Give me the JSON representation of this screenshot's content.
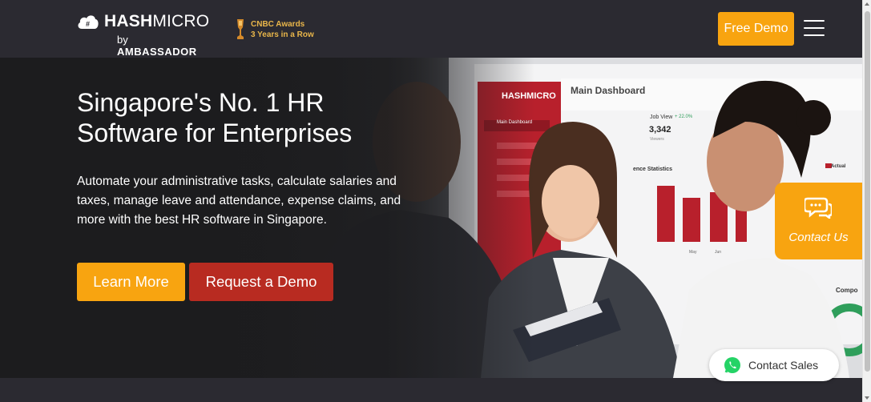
{
  "header": {
    "brand": "HASHMICRO",
    "byline_prefix": "by",
    "byline_name": "AMBASSADOR",
    "award_line1": "CNBC Awards",
    "award_line2": "3 Years in a Row",
    "free_demo_label": "Free Demo",
    "menu_icon": "hamburger-icon"
  },
  "hero": {
    "title": "Singapore's No. 1 HR Software for Enterprises",
    "description": "Automate your administrative tasks, calculate salaries and taxes, manage leave and attendance, expense claims, and more with the best HR software in Singapore.",
    "learn_more_label": "Learn More",
    "request_demo_label": "Request a Demo"
  },
  "dashboard_screen": {
    "brand": "HASHMICRO",
    "title": "Main Dashboard",
    "sidebar_item": "Main Dashboard",
    "job_view_label": "Job View",
    "job_view_value": "3,342",
    "job_view_change": "+ 22.0%",
    "job_view_sub": "Viewers",
    "stats_label": "ence Statistics",
    "legend_actual": "Actual",
    "month1": "May",
    "month2": "Jun",
    "comp_label": "Compo"
  },
  "widgets": {
    "contact_us_label": "Contact Us",
    "contact_us_icon": "chat-bubbles-icon",
    "contact_sales_label": "Contact Sales",
    "contact_sales_icon": "whatsapp-icon"
  },
  "colors": {
    "header_bg": "#2b2a31",
    "accent_orange": "#f8a410",
    "accent_red": "#b82b21",
    "award_gold": "#e9b64a"
  }
}
